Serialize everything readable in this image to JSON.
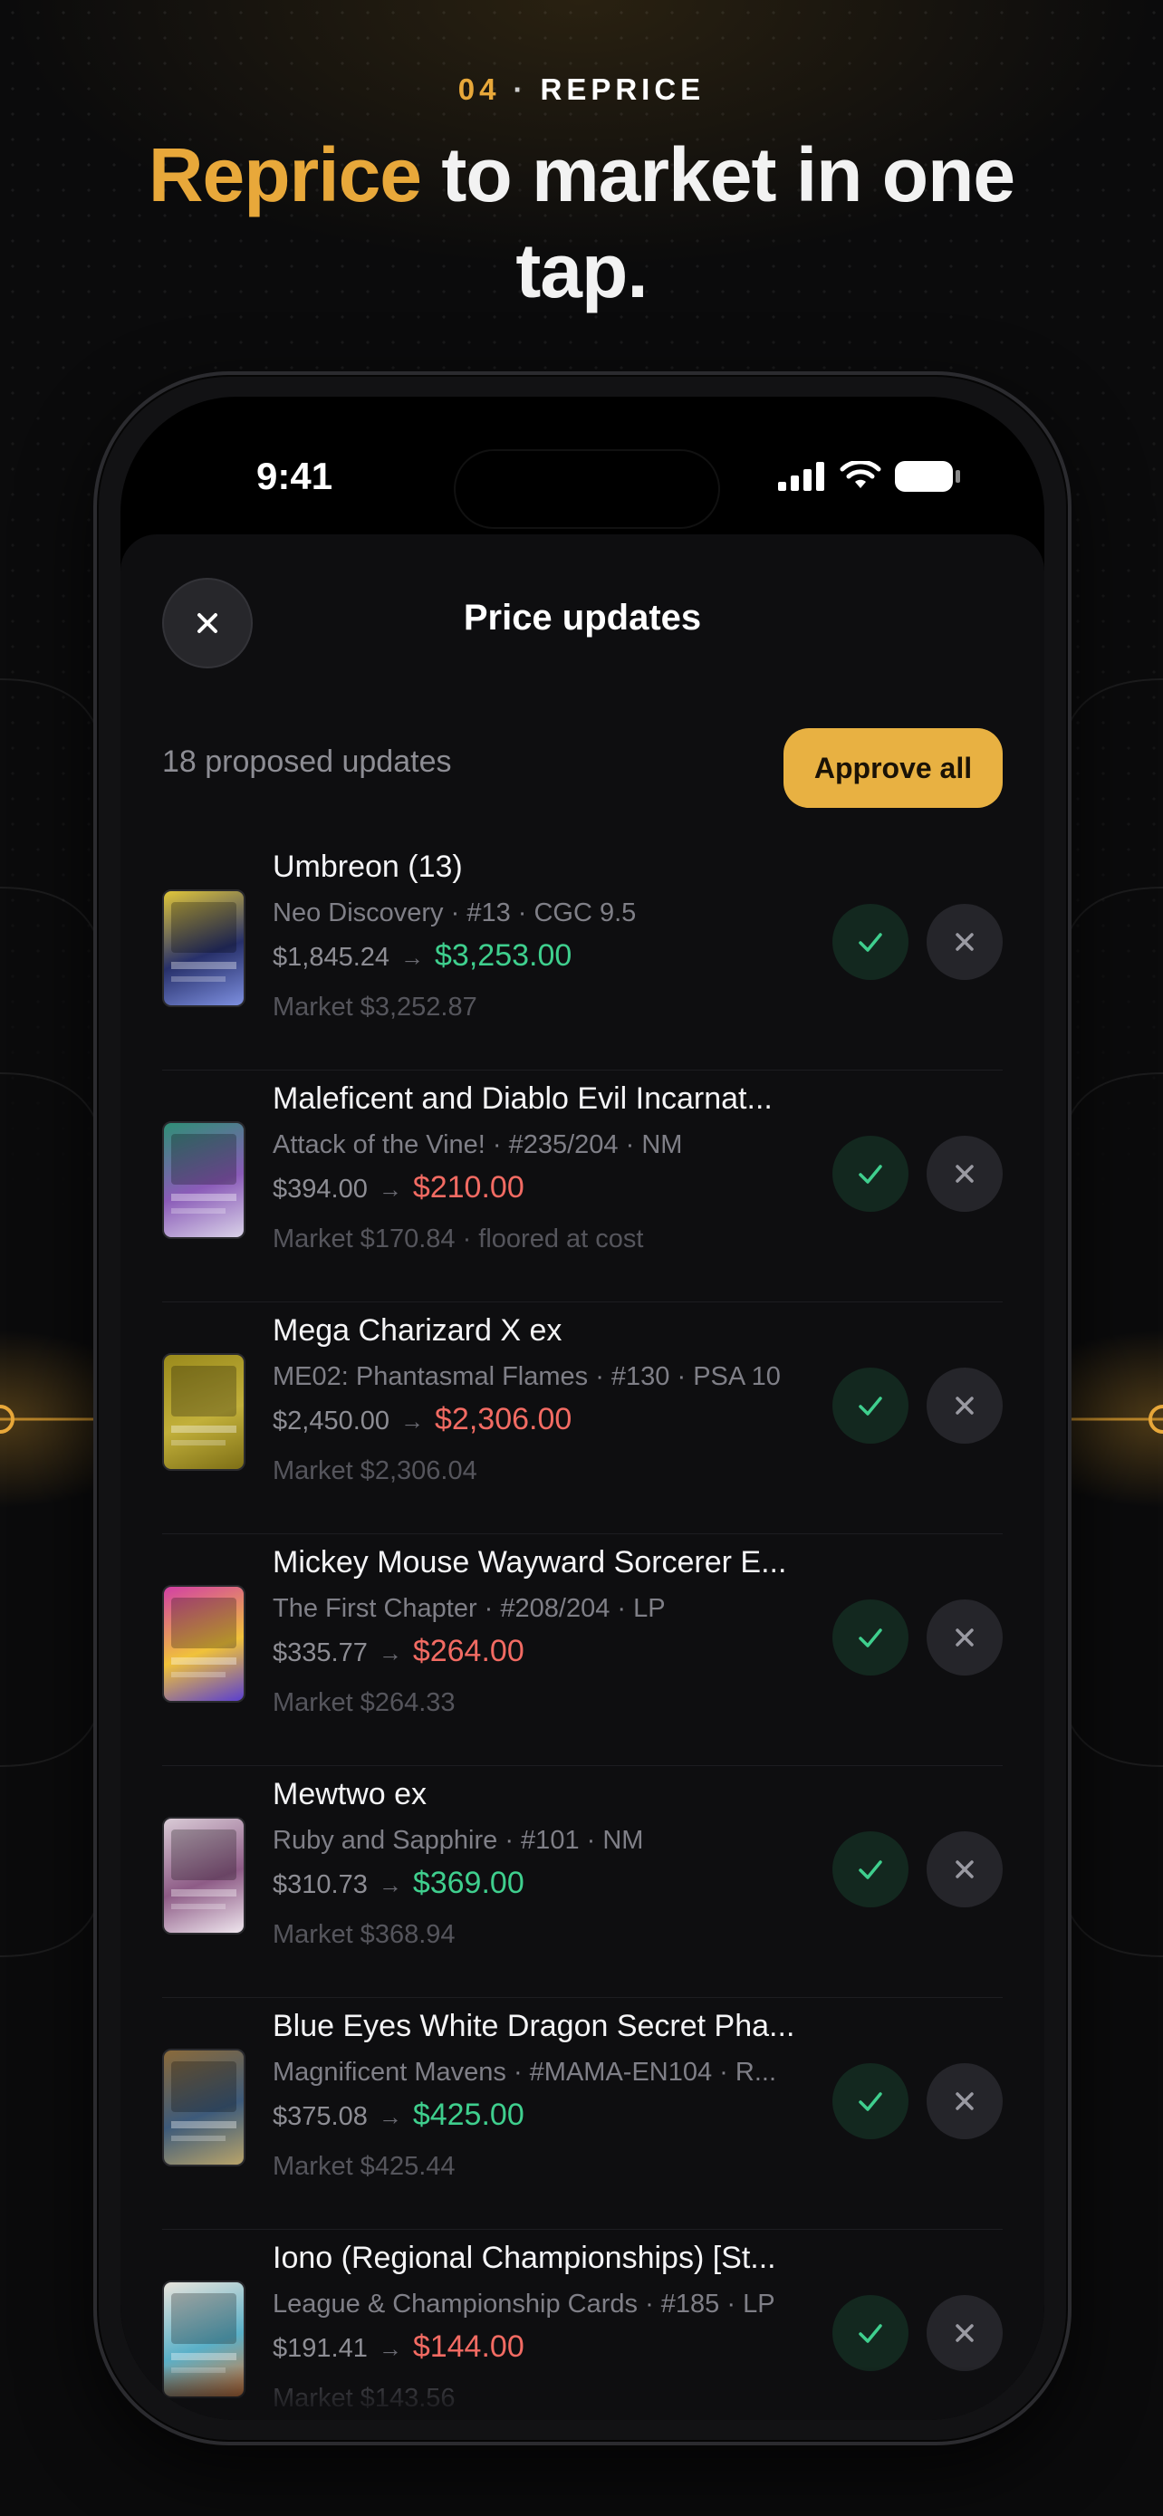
{
  "header": {
    "step_number": "04",
    "step_separator": "·",
    "step_label": "REPRICE",
    "headline_highlight": "Reprice",
    "headline_rest": " to market in one tap.",
    "accent_color": "#e8a83a"
  },
  "status_bar": {
    "time": "9:41",
    "icons": [
      "cellular-signal-icon",
      "wifi-icon",
      "battery-icon"
    ]
  },
  "sheet": {
    "title": "Price updates",
    "close_icon": "close-icon",
    "proposed_count": "18 proposed updates",
    "approve_all_label": "Approve all"
  },
  "colors": {
    "price_up": "#3fcf8e",
    "price_down": "#f26b63",
    "approve_button": "#e8b142"
  },
  "updates": [
    {
      "name": "Umbreon (13)",
      "meta": "Neo Discovery · #13 · CGC 9.5",
      "old_price": "$1,845.24",
      "arrow": "→",
      "new_price": "$3,253.00",
      "direction": "up",
      "market": "Market $3,252.87",
      "thumb_colors": [
        "#e0c63a",
        "#27306a",
        "#7d8fe0"
      ]
    },
    {
      "name": "Maleficent and Diablo Evil Incarnat...",
      "meta": "Attack of the Vine! · #235/204 · NM",
      "old_price": "$394.00",
      "arrow": "→",
      "new_price": "$210.00",
      "direction": "down",
      "market": "Market $170.84 · floored at cost",
      "thumb_colors": [
        "#2f8f76",
        "#8a5bb8",
        "#d9d2e8"
      ]
    },
    {
      "name": "Mega Charizard X ex",
      "meta": "ME02: Phantasmal Flames · #130 · PSA 10",
      "old_price": "$2,450.00",
      "arrow": "→",
      "new_price": "$2,306.00",
      "direction": "down",
      "market": "Market $2,306.04",
      "thumb_colors": [
        "#9a8a1c",
        "#c2b03a",
        "#7e6f16"
      ]
    },
    {
      "name": "Mickey Mouse Wayward Sorcerer E...",
      "meta": "The First Chapter · #208/204 · LP",
      "old_price": "$335.77",
      "arrow": "→",
      "new_price": "$264.00",
      "direction": "down",
      "market": "Market $264.33",
      "thumb_colors": [
        "#d23fa5",
        "#f0c23a",
        "#5a3fd0"
      ]
    },
    {
      "name": "Mewtwo ex",
      "meta": "Ruby and Sapphire · #101 · NM",
      "old_price": "$310.73",
      "arrow": "→",
      "new_price": "$369.00",
      "direction": "up",
      "market": "Market $368.94",
      "thumb_colors": [
        "#d9cbd6",
        "#8d5b86",
        "#efe6ee"
      ]
    },
    {
      "name": "Blue Eyes White Dragon Secret Pha...",
      "meta": "Magnificent Mavens · #MAMA-EN104 · R...",
      "old_price": "$375.08",
      "arrow": "→",
      "new_price": "$425.00",
      "direction": "up",
      "market": "Market $425.44",
      "thumb_colors": [
        "#8a6a3a",
        "#3d5a7a",
        "#b9a46a"
      ]
    },
    {
      "name": "Iono (Regional Championships) [St...",
      "meta": "League & Championship Cards · #185 · LP",
      "old_price": "$191.41",
      "arrow": "→",
      "new_price": "$144.00",
      "direction": "down",
      "market": "Market $143.56",
      "thumb_colors": [
        "#e8e4dc",
        "#5ab0c8",
        "#d97a3a"
      ]
    }
  ]
}
